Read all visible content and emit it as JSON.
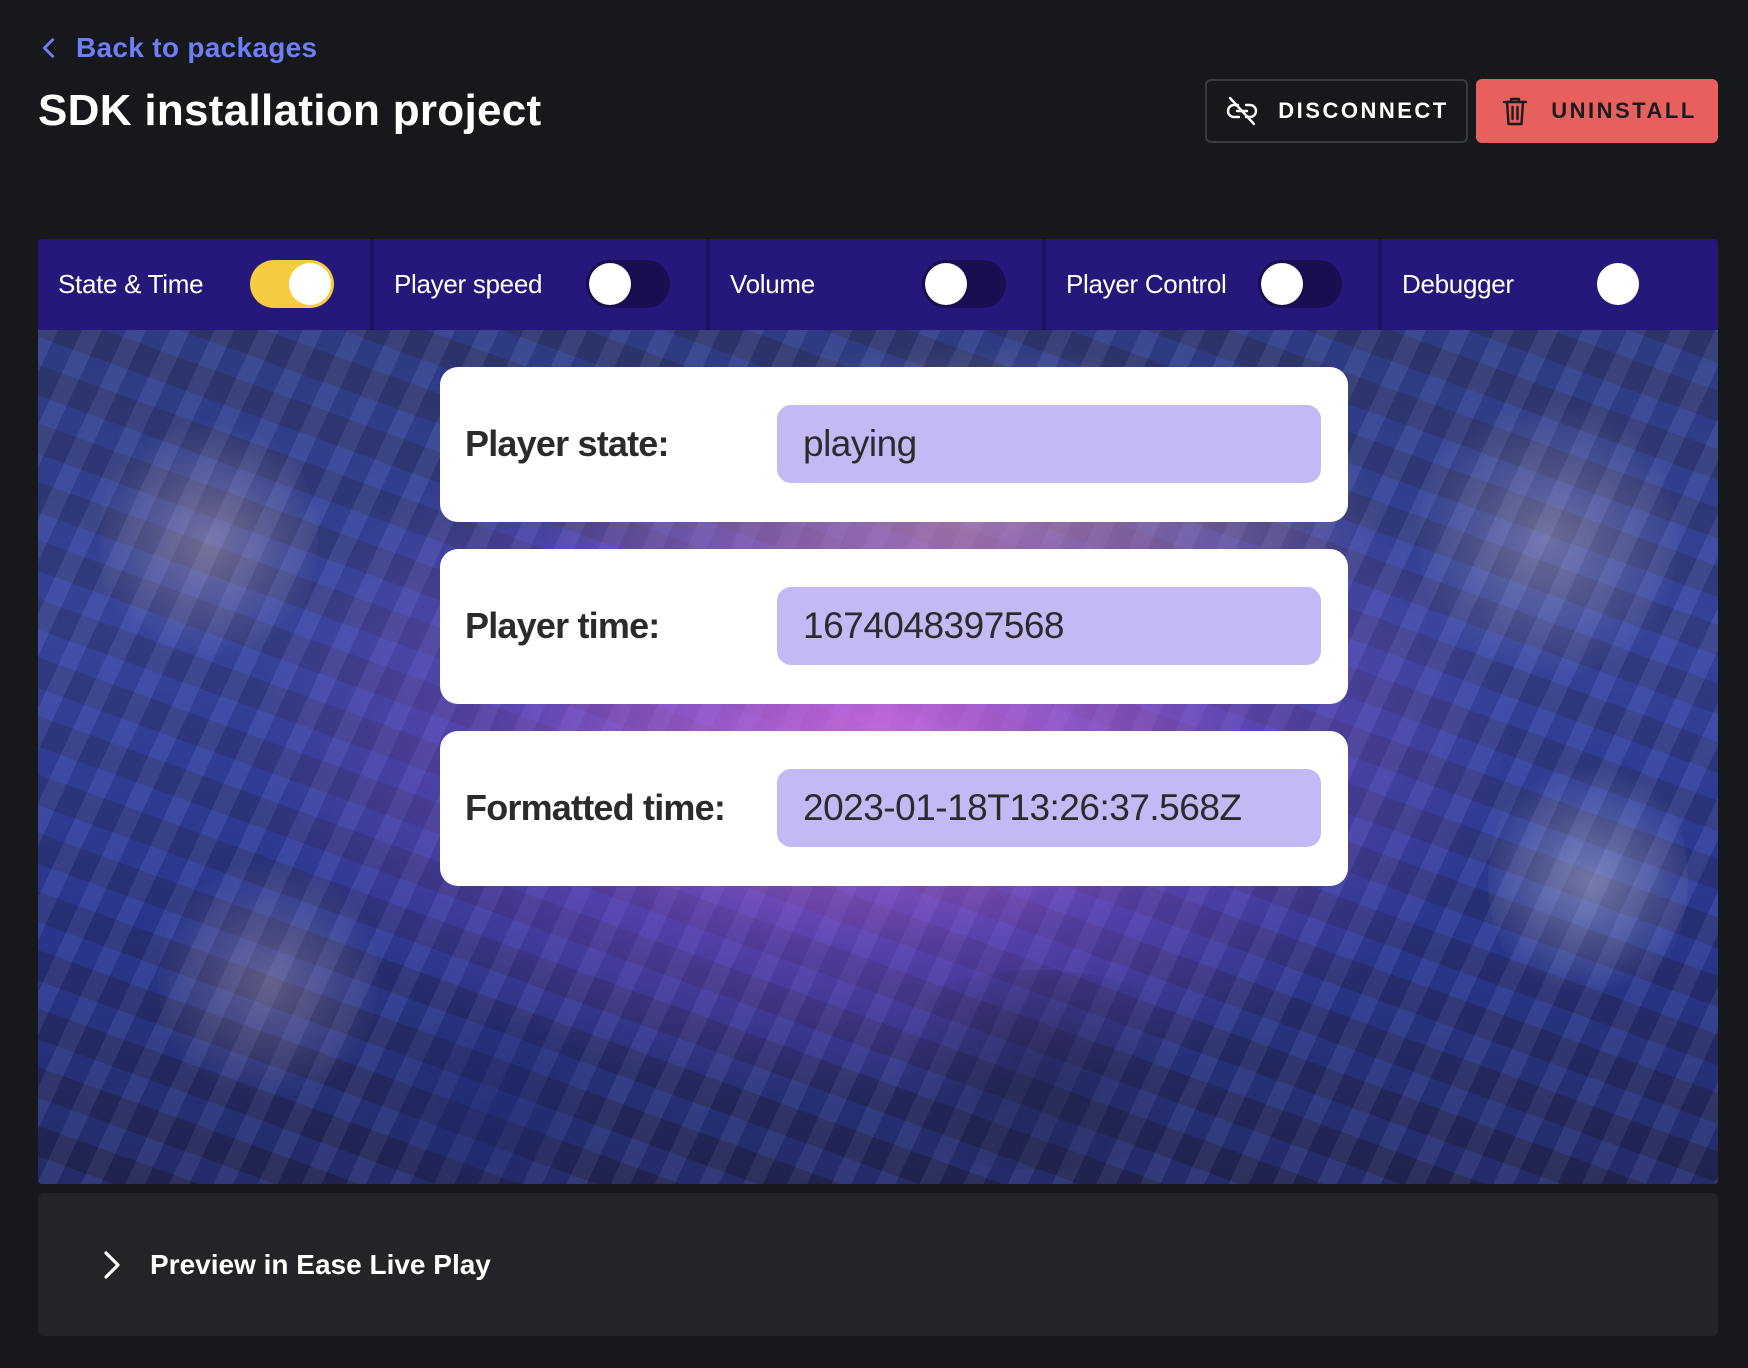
{
  "header": {
    "back_label": "Back to packages",
    "title": "SDK installation project",
    "disconnect_label": "DISCONNECT",
    "uninstall_label": "UNINSTALL"
  },
  "tabs": [
    {
      "label": "State & Time",
      "enabled": true
    },
    {
      "label": "Player speed",
      "enabled": false
    },
    {
      "label": "Volume",
      "enabled": false
    },
    {
      "label": "Player Control",
      "enabled": false
    },
    {
      "label": "Debugger",
      "enabled": false
    }
  ],
  "info": {
    "state_label": "Player state:",
    "state_value": "playing",
    "time_label": "Player time:",
    "time_value": "1674048397568",
    "formatted_label": "Formatted time:",
    "formatted_value": "2023-01-18T13:26:37.568Z"
  },
  "preview": {
    "label": "Preview in Ease Live Play"
  },
  "colors": {
    "accent_link": "#6e7ff3",
    "uninstall_bg": "#e8605d",
    "tabbar_bg": "#24197a",
    "toggle_on": "#f5cc40",
    "value_bg": "#c4b8f5"
  },
  "icons": {
    "back": "chevron-left-icon",
    "disconnect": "link-off-icon",
    "uninstall": "trash-icon",
    "preview": "chevron-right-icon"
  }
}
